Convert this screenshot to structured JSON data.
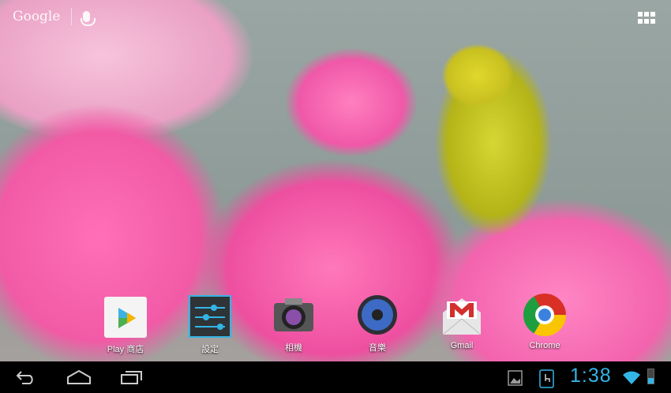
{
  "search": {
    "logo": "Google",
    "mic_icon": "microphone-icon"
  },
  "apps_button": "all-apps-grid-icon",
  "dock": [
    {
      "label": "Play 商店",
      "icon": "play-store-icon"
    },
    {
      "label": "設定",
      "icon": "settings-icon"
    },
    {
      "label": "相機",
      "icon": "camera-icon"
    },
    {
      "label": "音樂",
      "icon": "music-icon"
    },
    {
      "label": "Gmail",
      "icon": "gmail-icon"
    },
    {
      "label": "Chrome",
      "icon": "chrome-icon"
    }
  ],
  "status": {
    "time": "1:38",
    "accent": "#33b5e5"
  }
}
